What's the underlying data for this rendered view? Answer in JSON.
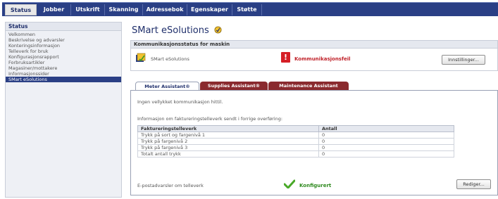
{
  "nav": {
    "tabs": [
      {
        "label": "Status",
        "active": true
      },
      {
        "label": "Jobber",
        "active": false
      },
      {
        "label": "Utskrift",
        "active": false
      },
      {
        "label": "Skanning",
        "active": false
      },
      {
        "label": "Adressebok",
        "active": false
      },
      {
        "label": "Egenskaper",
        "active": false
      },
      {
        "label": "Støtte",
        "active": false
      }
    ]
  },
  "sidebar": {
    "title": "Status",
    "items": [
      {
        "label": "Velkommen"
      },
      {
        "label": "Beskrivelse og advarsler"
      },
      {
        "label": "Konteringsinformasjon"
      },
      {
        "label": "Telleverk for bruk"
      },
      {
        "label": "Konfigurasjonsrapport"
      },
      {
        "label": "Forbruksartikler"
      },
      {
        "label": "Magasiner/mottakere"
      },
      {
        "label": "Informasjonssider"
      },
      {
        "label": "SMart eSolutions",
        "selected": true
      }
    ]
  },
  "main": {
    "title": "SMart eSolutions",
    "title_icon": "smart-esolutions-icon",
    "status_panel": {
      "title": "Kommunikasjonsstatus for maskin",
      "app_label": "SMart eSolutions",
      "status_text": "Kommunikasjonsfeil",
      "status_icon": "error-exclamation-icon",
      "settings_button": "Innstillinger..."
    },
    "assistant_tabs": [
      {
        "label": "Meter Assistant®",
        "active": true
      },
      {
        "label": "Supplies Assistant®",
        "active": false
      },
      {
        "label": "Maintenance Assistant",
        "active": false
      }
    ],
    "assistant": {
      "message": "Ingen vellykket kommunikasjon hittil.",
      "info_text": "Informasjon om faktureringstelleverk sendt i forrige overføring:",
      "table": {
        "headers": [
          "Faktureringstelleverk",
          "Antall"
        ],
        "rows": [
          [
            "Trykk på sort og fargenivå 1",
            "0"
          ],
          [
            "Trykk på fargenivå 2",
            "0"
          ],
          [
            "Trykk på fargenivå 3",
            "0"
          ],
          [
            "Totalt antall trykk",
            "0"
          ]
        ]
      },
      "email_label": "E-postadvarsler om telleverk",
      "email_status": "Konfigurert",
      "edit_button": "Rediger..."
    }
  },
  "colors": {
    "nav_bg": "#2a3f85",
    "error_red": "#c0222a",
    "ok_green": "#2f8a1f",
    "inactive_tab": "#8a2a2e"
  }
}
